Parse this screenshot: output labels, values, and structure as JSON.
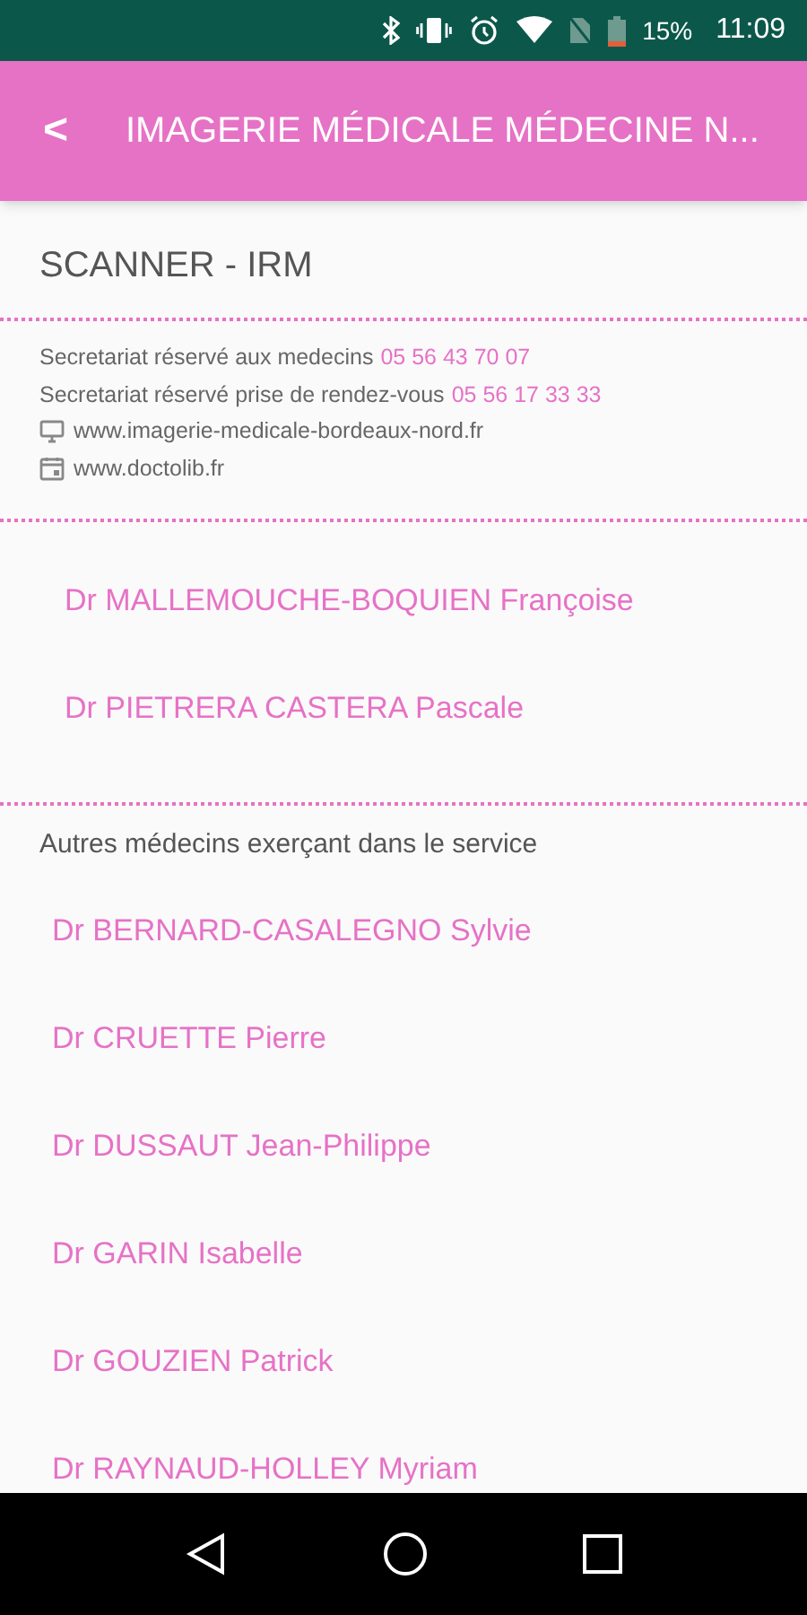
{
  "status_bar": {
    "battery": "15%",
    "time": "11:09"
  },
  "app_bar": {
    "back": "<",
    "title": "IMAGERIE MÉDICALE MÉDECINE N..."
  },
  "service": {
    "title": "SCANNER - IRM",
    "phones": [
      {
        "label": "Secretariat réservé aux medecins",
        "number": "05 56 43 70 07"
      },
      {
        "label": "Secretariat réservé prise de rendez-vous",
        "number": "05 56 17 33 33"
      }
    ],
    "links": [
      {
        "kind": "website",
        "text": "www.imagerie-medicale-bordeaux-nord.fr"
      },
      {
        "kind": "booking",
        "text": "www.doctolib.fr"
      }
    ]
  },
  "main_doctors": [
    "Dr MALLEMOUCHE-BOQUIEN Françoise",
    "Dr PIETRERA CASTERA Pascale"
  ],
  "other_doctors": {
    "heading": "Autres médecins exerçant dans le service",
    "items": [
      "Dr BERNARD-CASALEGNO Sylvie",
      "Dr CRUETTE Pierre",
      "Dr DUSSAUT Jean-Philippe",
      "Dr GARIN Isabelle",
      "Dr GOUZIEN Patrick",
      "Dr RAYNAUD-HOLLEY Myriam"
    ]
  }
}
